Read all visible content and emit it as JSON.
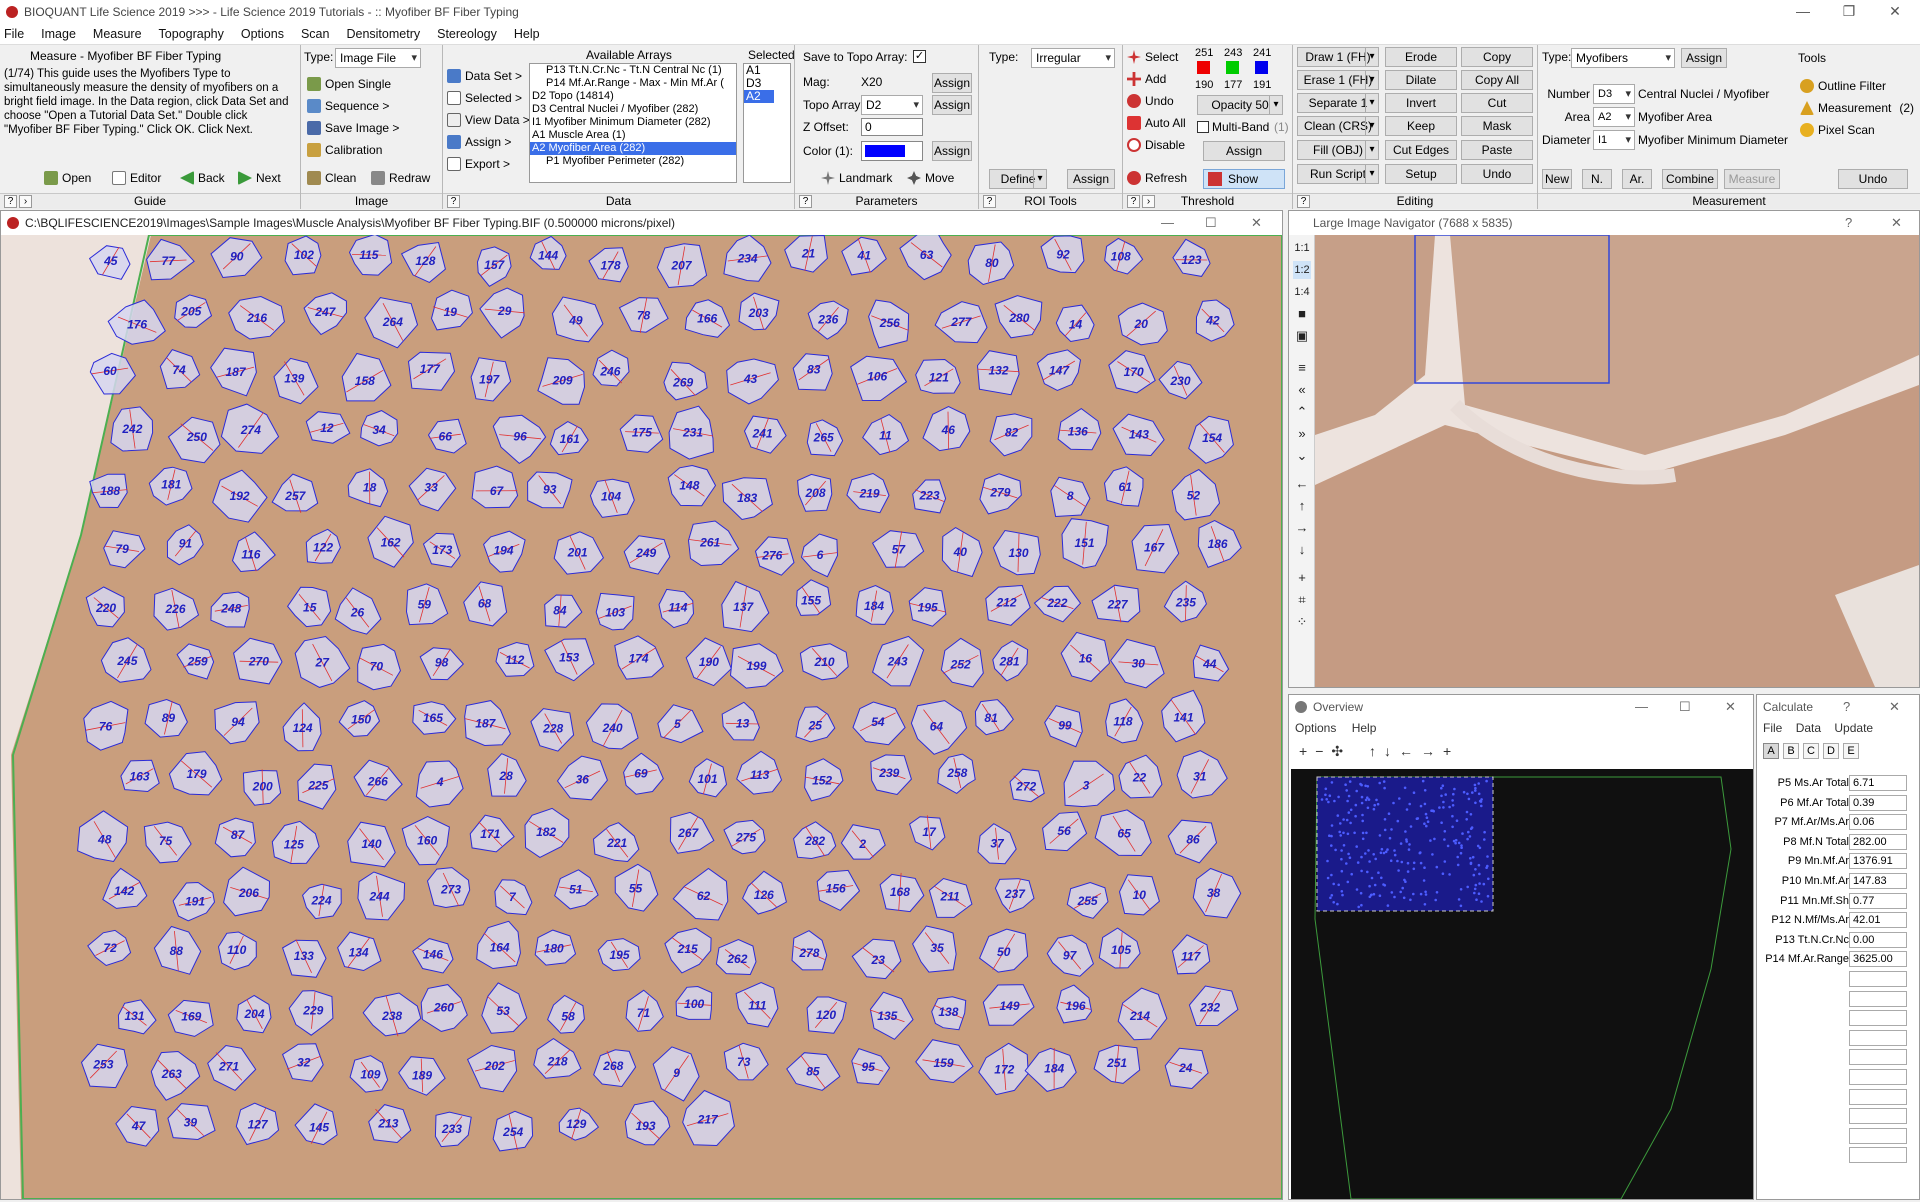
{
  "app": {
    "title": "BIOQUANT Life Science 2019 >>> - Life Science 2019 Tutorials - :: Myofiber BF Fiber Typing",
    "menu": [
      "File",
      "Image",
      "Measure",
      "Topography",
      "Options",
      "Scan",
      "Densitometry",
      "Stereology",
      "Help"
    ]
  },
  "guide": {
    "title": "Measure - Myofiber BF Fiber Typing",
    "text": "(1/74) This guide uses the Myofibers Type to simultaneously measure the density of myofibers on a bright field image. In the Data region, click Data Set and choose \"Open a Tutorial Data Set.\" Double click \"Myofiber BF Fiber Typing.\" Click OK. Click Next.",
    "open": "Open",
    "editor": "Editor",
    "back": "Back",
    "next": "Next",
    "footer": "Guide"
  },
  "image_panel": {
    "type_label": "Type:",
    "type_value": "Image File",
    "buttons": [
      "Open Single",
      "Sequence >",
      "Save Image >",
      "Calibration"
    ],
    "clean": "Clean",
    "redraw": "Redraw",
    "footer": "Image"
  },
  "data_panel": {
    "menu": [
      "Data Set >",
      "Selected >",
      "View Data >",
      "Assign >",
      "Export >"
    ],
    "available_title": "Available Arrays",
    "arrays": [
      "P13 Tt.N.Cr.Nc - Tt.N Central Nc (1)",
      "P14 Mf.Ar.Range - Max - Min Mf.Ar (",
      "D2 Topo (14814)",
      "D3 Central Nuclei / Myofiber (282)",
      "I1 Myofiber Minimum Diameter (282)",
      "A1 Muscle Area (1)",
      "A2 Myofiber Area (282)",
      "P1 Myofiber Perimeter (282)"
    ],
    "selected_title": "Selected",
    "selected": [
      "A1",
      "D3",
      "A2"
    ],
    "footer": "Data"
  },
  "params_panel": {
    "save_topo": "Save to Topo Array:",
    "mag_label": "Mag:",
    "mag_value": "X20",
    "topo_label": "Topo Array:",
    "topo_value": "D2",
    "zoff_label": "Z Offset:",
    "zoff_value": "0",
    "color_label": "Color (1):",
    "assign": "Assign",
    "landmark": "Landmark",
    "move": "Move",
    "footer": "Parameters"
  },
  "roi_panel": {
    "type_label": "Type:",
    "type_value": "Irregular",
    "define": "Define",
    "assign": "Assign",
    "footer": "ROI Tools"
  },
  "threshold_panel": {
    "select": "Select",
    "add": "Add",
    "undo": "Undo",
    "auto_all": "Auto All",
    "disable": "Disable",
    "refresh": "Refresh",
    "rgb_top": [
      "251",
      "243",
      "241"
    ],
    "rgb_bottom": [
      "190",
      "177",
      "191"
    ],
    "opacity": "Opacity 50",
    "multiband": "Multi-Band",
    "multiband_n": "(1)",
    "assign": "Assign",
    "show": "Show",
    "footer": "Threshold"
  },
  "editing_panel": {
    "left": [
      "Draw 1 (FH)",
      "Erase 1 (FH)",
      "Separate 1",
      "Clean (CRS)",
      "Fill (OBJ)",
      "Run Script"
    ],
    "mid": [
      "Erode",
      "Dilate",
      "Invert",
      "Keep",
      "Cut Edges",
      "Setup"
    ],
    "right": [
      "Copy",
      "Copy All",
      "Cut",
      "Mask",
      "Paste",
      "Undo"
    ],
    "footer": "Editing"
  },
  "measure_panel": {
    "type_label": "Type:",
    "type_value": "Myofibers",
    "assign": "Assign",
    "rows": [
      {
        "label": "Number",
        "value": "D3",
        "desc": "Central Nuclei / Myofiber"
      },
      {
        "label": "Area",
        "value": "A2",
        "desc": "Myofiber Area"
      },
      {
        "label": "Diameter",
        "value": "I1",
        "desc": "Myofiber Minimum Diameter"
      }
    ],
    "tools_title": "Tools",
    "tools": [
      "Outline Filter",
      "Measurement",
      "Pixel Scan"
    ],
    "measurement_n": "(2)",
    "bottom": [
      "New",
      "N.",
      "Ar.",
      "Combine",
      "Measure",
      "Undo"
    ],
    "footer": "Measurement"
  },
  "image_window": {
    "title": "C:\\BQLIFESCIENCE2019\\Images\\Sample Images\\Muscle Analysis\\Myofiber BF Fiber Typing.BIF (0.500000 microns/pixel)"
  },
  "navigator": {
    "title": "Large Image Navigator (7688 x 5835)",
    "zoom": [
      "1:1",
      "1:2",
      "1:4"
    ]
  },
  "overview": {
    "title": "Overview",
    "menu": [
      "Options",
      "Help"
    ]
  },
  "calculate": {
    "title": "Calculate",
    "menu": [
      "File",
      "Data",
      "Update"
    ],
    "tabs": [
      "A",
      "B",
      "C",
      "D",
      "E"
    ],
    "rows": [
      {
        "k": "P5 Ms.Ar Total",
        "v": "6.71"
      },
      {
        "k": "P6 Mf.Ar Total",
        "v": "0.39"
      },
      {
        "k": "P7 Mf.Ar/Ms.Ar",
        "v": "0.06"
      },
      {
        "k": "P8 Mf.N Total",
        "v": "282.00"
      },
      {
        "k": "P9 Mn.Mf.Ar",
        "v": "1376.91"
      },
      {
        "k": "P10 Mn.Mf.Ar",
        "v": "147.83"
      },
      {
        "k": "P11 Mn.Mf.Sh",
        "v": "0.77"
      },
      {
        "k": "P12 N.Mf/Ms.Ar",
        "v": "42.01"
      },
      {
        "k": "P13 Tt.N.Cr.Nc",
        "v": "0.00"
      },
      {
        "k": "P14 Mf.Ar.Range",
        "v": "3625.00"
      }
    ]
  },
  "fibers": [
    "45",
    "77",
    "90",
    "102",
    "115",
    "128",
    "157",
    "144",
    "178",
    "207",
    "234",
    "21",
    "41",
    "63",
    "80",
    "92",
    "108",
    "123",
    "176",
    "205",
    "216",
    "247",
    "264",
    "19",
    "29",
    "49",
    "78",
    "166",
    "203",
    "236",
    "256",
    "277",
    "280",
    "14",
    "20",
    "42",
    "60",
    "74",
    "187",
    "139",
    "158",
    "177",
    "197",
    "209",
    "246",
    "269",
    "43",
    "83",
    "106",
    "121",
    "132",
    "147",
    "170",
    "230",
    "242",
    "250",
    "274",
    "12",
    "34",
    "66",
    "96",
    "161",
    "175",
    "231",
    "241",
    "265",
    "11",
    "46",
    "82",
    "136",
    "143",
    "154",
    "188",
    "181",
    "192",
    "257",
    "18",
    "33",
    "67",
    "93",
    "104",
    "148",
    "183",
    "208",
    "219",
    "223",
    "279",
    "8",
    "61",
    "52",
    "79",
    "91",
    "116",
    "122",
    "162",
    "173",
    "194",
    "201",
    "249",
    "261",
    "276",
    "6",
    "57",
    "40",
    "130",
    "151",
    "167",
    "186",
    "220",
    "226",
    "248",
    "15",
    "26",
    "59",
    "68",
    "84",
    "103",
    "114",
    "137",
    "155",
    "184",
    "195",
    "212",
    "222",
    "227",
    "235",
    "245",
    "259",
    "270",
    "27",
    "70",
    "98",
    "112",
    "153",
    "174",
    "190",
    "199",
    "210",
    "243",
    "252",
    "281",
    "16",
    "30",
    "44",
    "76",
    "89",
    "94",
    "124",
    "150",
    "165",
    "187",
    "228",
    "240",
    "5",
    "13",
    "25",
    "54",
    "64",
    "81",
    "99",
    "118",
    "141",
    "163",
    "179",
    "200",
    "225",
    "266",
    "4",
    "28",
    "36",
    "69",
    "101",
    "113",
    "152",
    "239",
    "258",
    "272",
    "3",
    "22",
    "31",
    "48",
    "75",
    "87",
    "125",
    "140",
    "160",
    "171",
    "182",
    "221",
    "267",
    "275",
    "282",
    "2",
    "17",
    "37",
    "56",
    "65",
    "86",
    "142",
    "191",
    "206",
    "224",
    "244",
    "273",
    "7",
    "51",
    "55",
    "62",
    "126",
    "156",
    "168",
    "211",
    "237",
    "255",
    "10",
    "38",
    "72",
    "88",
    "110",
    "133",
    "134",
    "146",
    "164",
    "180",
    "195",
    "215",
    "262",
    "278",
    "23",
    "35",
    "50",
    "97",
    "105",
    "117",
    "131",
    "169",
    "204",
    "229",
    "238",
    "260",
    "53",
    "58",
    "71",
    "100",
    "111",
    "120",
    "135",
    "138",
    "149",
    "196",
    "214",
    "232",
    "253",
    "263",
    "271",
    "32",
    "109",
    "189",
    "202",
    "218",
    "268",
    "9",
    "73",
    "85",
    "95",
    "159",
    "172",
    "184",
    "251",
    "24",
    "47",
    "39",
    "127",
    "145",
    "213",
    "233",
    "254",
    "129",
    "193",
    "217"
  ]
}
